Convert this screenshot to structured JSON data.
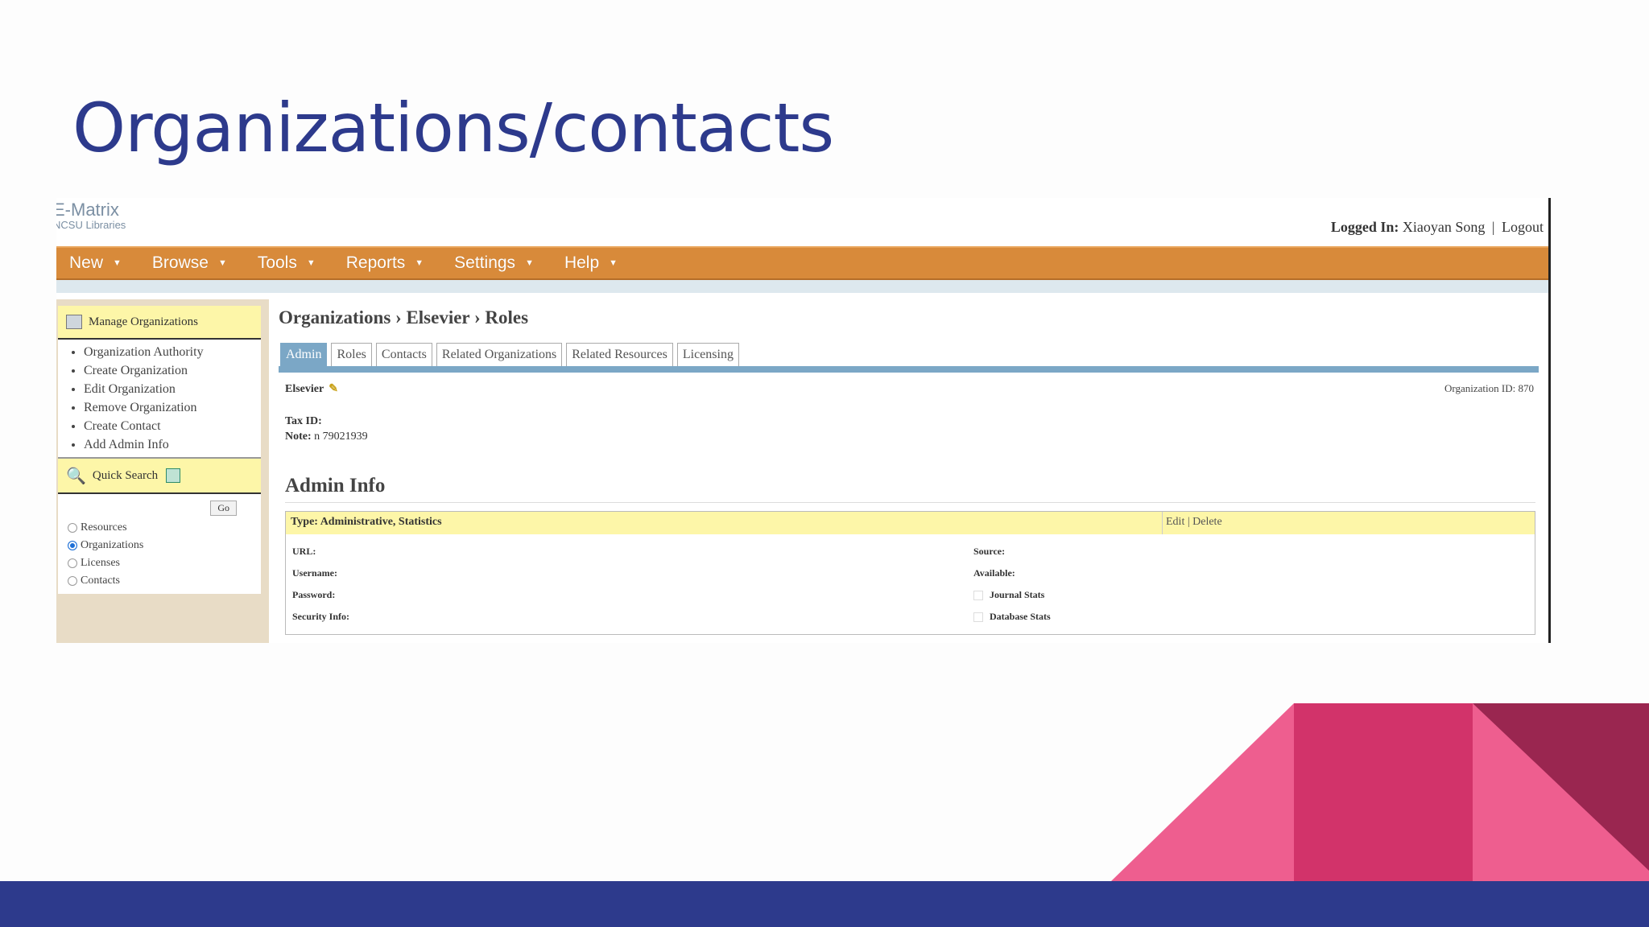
{
  "slide": {
    "title": "Organizations/contacts"
  },
  "app": {
    "logo_name": "E-Matrix",
    "logo_sub": "NCSU Libraries",
    "login_label": "Logged In:",
    "login_user": "Xiaoyan Song",
    "login_sep": "|",
    "logout": "Logout"
  },
  "nav": [
    "New",
    "Browse",
    "Tools",
    "Reports",
    "Settings",
    "Help"
  ],
  "sidebar": {
    "manage_title": "Manage Organizations",
    "items": [
      "Organization Authority",
      "Create Organization",
      "Edit Organization",
      "Remove Organization",
      "Create Contact",
      "Add Admin Info"
    ],
    "quick_search_title": "Quick Search",
    "go_label": "Go",
    "radios": [
      {
        "label": "Resources",
        "checked": false
      },
      {
        "label": "Organizations",
        "checked": true
      },
      {
        "label": "Licenses",
        "checked": false
      },
      {
        "label": "Contacts",
        "checked": false
      }
    ]
  },
  "main": {
    "breadcrumb": "Organizations › Elsevier › Roles",
    "tabs": [
      "Admin",
      "Roles",
      "Contacts",
      "Related Organizations",
      "Related Resources",
      "Licensing"
    ],
    "active_tab": "Admin",
    "org_name": "Elsevier",
    "org_id": "Organization ID: 870",
    "tax_label": "Tax ID:",
    "note_label": "Note:",
    "note_value": "n 79021939",
    "admin_title": "Admin Info",
    "admin_type": "Type: Administrative, Statistics",
    "admin_actions": "Edit | Delete",
    "fields_left": [
      "URL:",
      "Username:",
      "Password:",
      "Security Info:"
    ],
    "fields_right": [
      "Source:",
      "Available:",
      "Journal Stats",
      "Database Stats"
    ]
  },
  "colors": {
    "title": "#2d3a8c",
    "nav": "#d88a3a",
    "tab_active": "#7ba7c6",
    "highlight": "#fdf6a8",
    "deco_pink": "#ee5e8f",
    "deco_magenta": "#d2336a",
    "deco_plum": "#9a2650",
    "footer": "#2d3a8c"
  }
}
